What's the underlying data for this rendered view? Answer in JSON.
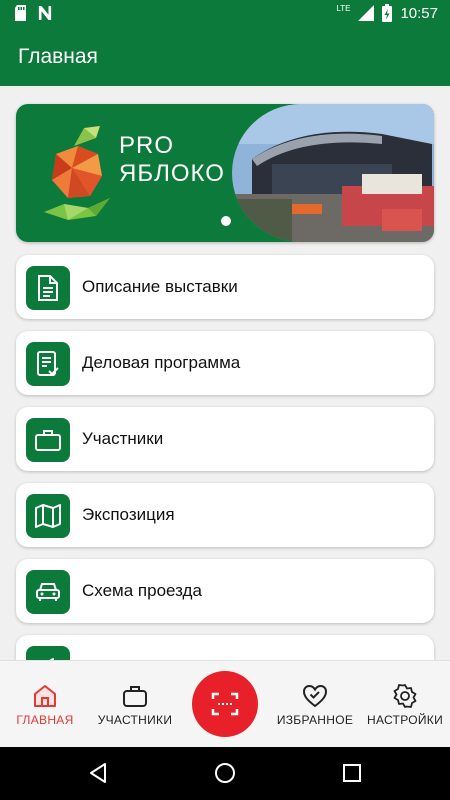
{
  "status_bar": {
    "time": "10:57",
    "network": "LTE",
    "icons": [
      "sd-card-icon",
      "notification-n-icon",
      "signal-icon",
      "battery-charging-icon"
    ]
  },
  "app_bar": {
    "title": "Главная"
  },
  "banner": {
    "logo_line1": "PRO",
    "logo_line2": "ЯБЛОКО"
  },
  "menu": {
    "items": [
      {
        "label": "Описание выставки",
        "icon": "document-icon"
      },
      {
        "label": "Деловая программа",
        "icon": "checklist-icon"
      },
      {
        "label": "Участники",
        "icon": "briefcase-icon"
      },
      {
        "label": "Экспозиция",
        "icon": "map-icon"
      },
      {
        "label": "Схема проезда",
        "icon": "car-icon"
      },
      {
        "label": "",
        "icon": "megaphone-icon"
      }
    ]
  },
  "bottom_nav": {
    "home": "ГЛАВНАЯ",
    "participants": "УЧАСТНИКИ",
    "favorites": "ИЗБРАННОЕ",
    "settings": "НАСТРОЙКИ"
  },
  "colors": {
    "primary": "#0b7a3b",
    "accent": "#e8202a",
    "active_nav": "#e53935"
  }
}
